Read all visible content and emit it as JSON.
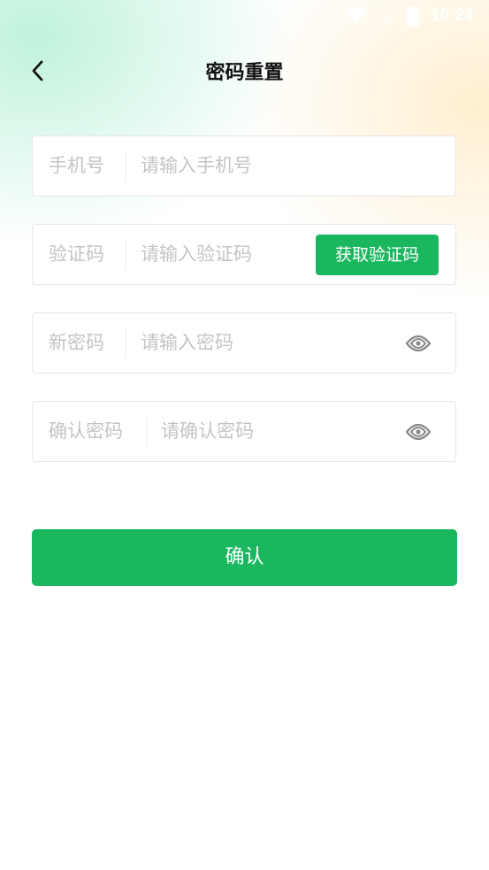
{
  "status_bar": {
    "time": "10:24",
    "icons": [
      "wifi-icon",
      "signal-icon",
      "battery-icon"
    ]
  },
  "header": {
    "back_icon": "chevron-left-icon",
    "title": "密码重置"
  },
  "form": {
    "phone": {
      "label": "手机号",
      "placeholder": "请输入手机号",
      "value": ""
    },
    "code": {
      "label": "验证码",
      "placeholder": "请输入验证码",
      "value": "",
      "button_label": "获取验证码"
    },
    "new_password": {
      "label": "新密码",
      "placeholder": "请输入密码",
      "value": "",
      "toggle_icon": "eye-icon"
    },
    "confirm_password": {
      "label": "确认密码",
      "placeholder": "请确认密码",
      "value": "",
      "toggle_icon": "eye-icon"
    }
  },
  "confirm_button": {
    "label": "确认"
  },
  "colors": {
    "accent": "#1bb75f",
    "placeholder": "#c4c4c4",
    "border": "#e6e6e6"
  }
}
